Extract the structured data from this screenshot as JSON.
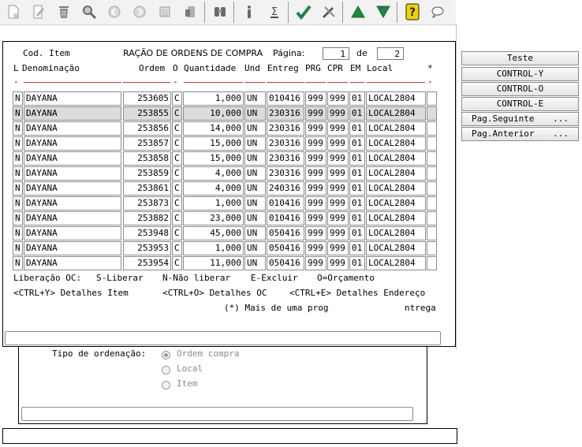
{
  "header": {
    "cod_item_label": "Cod. Item",
    "title": "RAÇÃO DE ORDENS DE COMPRA",
    "page_label": "Página:",
    "page_current": "1",
    "of_label": "de",
    "page_total": "2"
  },
  "columns": {
    "l": "L",
    "denominacao": "Denominação",
    "ordem": "Ordem",
    "o": "O",
    "quantidade": "Quantidade",
    "und": "Und",
    "entreg": "Entreg",
    "prg": "PRG",
    "cpr": "CPR",
    "em": "EM",
    "local": "Local",
    "star": "*"
  },
  "rows": [
    {
      "l": "N",
      "den": "DAYANA",
      "ordem": "253605",
      "o": "C",
      "qtd": "1,000",
      "und": "UN",
      "entreg": "010416",
      "prg": "999",
      "cpr": "999",
      "em": "01",
      "local": "LOCAL2804"
    },
    {
      "l": "N",
      "den": "DAYANA",
      "ordem": "253855",
      "o": "C",
      "qtd": "10,000",
      "und": "UN",
      "entreg": "230316",
      "prg": "999",
      "cpr": "999",
      "em": "01",
      "local": "LOCAL2804"
    },
    {
      "l": "N",
      "den": "DAYANA",
      "ordem": "253856",
      "o": "C",
      "qtd": "14,000",
      "und": "UN",
      "entreg": "230316",
      "prg": "999",
      "cpr": "999",
      "em": "01",
      "local": "LOCAL2804"
    },
    {
      "l": "N",
      "den": "DAYANA",
      "ordem": "253857",
      "o": "C",
      "qtd": "15,000",
      "und": "UN",
      "entreg": "230316",
      "prg": "999",
      "cpr": "999",
      "em": "01",
      "local": "LOCAL2804"
    },
    {
      "l": "N",
      "den": "DAYANA",
      "ordem": "253858",
      "o": "C",
      "qtd": "15,000",
      "und": "UN",
      "entreg": "230316",
      "prg": "999",
      "cpr": "999",
      "em": "01",
      "local": "LOCAL2804"
    },
    {
      "l": "N",
      "den": "DAYANA",
      "ordem": "253859",
      "o": "C",
      "qtd": "4,000",
      "und": "UN",
      "entreg": "230316",
      "prg": "999",
      "cpr": "999",
      "em": "01",
      "local": "LOCAL2804"
    },
    {
      "l": "N",
      "den": "DAYANA",
      "ordem": "253861",
      "o": "C",
      "qtd": "4,000",
      "und": "UN",
      "entreg": "240316",
      "prg": "999",
      "cpr": "999",
      "em": "01",
      "local": "LOCAL2804"
    },
    {
      "l": "N",
      "den": "DAYANA",
      "ordem": "253873",
      "o": "C",
      "qtd": "1,000",
      "und": "UN",
      "entreg": "010416",
      "prg": "999",
      "cpr": "999",
      "em": "01",
      "local": "LOCAL2804"
    },
    {
      "l": "N",
      "den": "DAYANA",
      "ordem": "253882",
      "o": "C",
      "qtd": "23,000",
      "und": "UN",
      "entreg": "010416",
      "prg": "999",
      "cpr": "999",
      "em": "01",
      "local": "LOCAL2804"
    },
    {
      "l": "N",
      "den": "DAYANA",
      "ordem": "253948",
      "o": "C",
      "qtd": "45,000",
      "und": "UN",
      "entreg": "050416",
      "prg": "999",
      "cpr": "999",
      "em": "01",
      "local": "LOCAL2804"
    },
    {
      "l": "N",
      "den": "DAYANA",
      "ordem": "253953",
      "o": "C",
      "qtd": "1,000",
      "und": "UN",
      "entreg": "050416",
      "prg": "999",
      "cpr": "999",
      "em": "01",
      "local": "LOCAL2804"
    },
    {
      "l": "N",
      "den": "DAYANA",
      "ordem": "253954",
      "o": "C",
      "qtd": "11,000",
      "und": "UN",
      "entreg": "050416",
      "prg": "999",
      "cpr": "999",
      "em": "01",
      "local": "LOCAL2804"
    }
  ],
  "selected_row": 1,
  "legend": {
    "line1_a": "Liberação OC:",
    "line1_b": "S-Liberar",
    "line1_c": "N-Não liberar",
    "line1_d": "E-Excluir",
    "line1_e": "O=Orçamento",
    "line2_a": "<CTRL+Y> Detalhes Item",
    "line2_b": "<CTRL+O> Detalhes OC",
    "line2_c": "<CTRL+E> Detalhes Endereço",
    "line3_a": "(*) Mais de uma prog",
    "line3_b": "ntrega"
  },
  "side_buttons": [
    {
      "label": "Teste",
      "ellipsis": ""
    },
    {
      "label": "CONTROL-Y",
      "ellipsis": ""
    },
    {
      "label": "CONTROL-O",
      "ellipsis": ""
    },
    {
      "label": "CONTROL-E",
      "ellipsis": ""
    },
    {
      "label": "Pag.Seguinte",
      "ellipsis": "..."
    },
    {
      "label": "Pag.Anterior",
      "ellipsis": "..."
    }
  ],
  "ordering": {
    "label": "Tipo de ordenação:",
    "options": [
      "Ordem compra",
      "Local",
      "Item"
    ],
    "selected": "Ordem compra"
  },
  "toolbar": {
    "icons": [
      "new-document-icon",
      "edit-icon",
      "trash-icon",
      "search-icon",
      "circle-back-icon",
      "circle-forward-icon",
      "print-icon",
      "export-icon",
      "binoculars-icon",
      "info-icon",
      "sigma-icon",
      "check-icon",
      "tools-icon",
      "triangle-up-icon",
      "triangle-down-icon",
      "help-icon",
      "chat-icon"
    ]
  },
  "colors": {
    "accent_green": "#1f8a3a",
    "help_yellow": "#f4d000",
    "underline_red": "#e03030",
    "selected_row": "#dcdcdc"
  }
}
